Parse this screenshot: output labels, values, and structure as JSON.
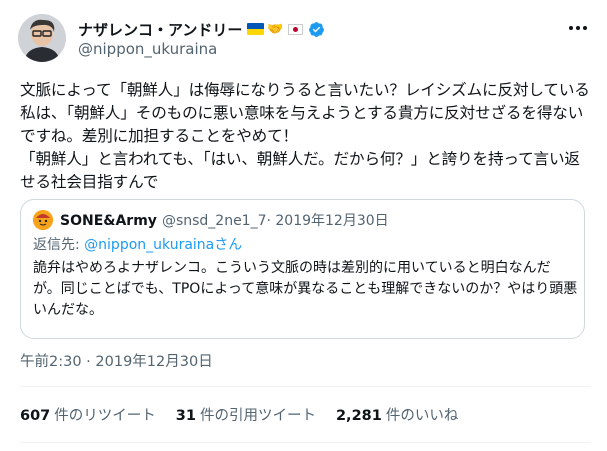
{
  "author": {
    "display_name": "ナザレンコ・アンドリー",
    "handle": "@nippon_ukuraina",
    "badge_emojis": [
      "ukraine-flag",
      "handshake",
      "japan-flag"
    ],
    "verified": true
  },
  "tweet": {
    "text": "文脈によって「朝鮮人」は侮辱になりうると言いたい？レイシズムに反対している私は、「朝鮮人」そのものに悪い意味を与えようとする貴方に反対せざるを得ないですね。差別に加担することをやめて！\n「朝鮮人」と言われても、「はい、朝鮮人だ。だから何？」と誇りを持って言い返せる社会目指すんで"
  },
  "quote": {
    "display_name": "SONE&Army",
    "handle": "@snsd_2ne1_7",
    "date": "· 2019年12月30日",
    "reply_prefix": "返信先: ",
    "reply_to": "@nippon_ukurainaさん",
    "text": "詭弁はやめろよナザレンコ。こういう文脈の時は差別的に用いていると明白なんだが。同じことばでも、TPOによって意味が異なることも理解できないのか？やはり頭悪いんだな。"
  },
  "timestamp": "午前2:30 · 2019年12月30日",
  "stats": {
    "retweets_count": "607",
    "retweets_label": "件のリツイート",
    "quotes_count": "31",
    "quotes_label": "件の引用ツイート",
    "likes_count": "2,281",
    "likes_label": "件のいいね"
  },
  "colors": {
    "text_primary": "#0f1419",
    "text_secondary": "#536471",
    "link": "#1d9bf0",
    "border": "#cfd9de",
    "verified": "#1d9bf0"
  }
}
